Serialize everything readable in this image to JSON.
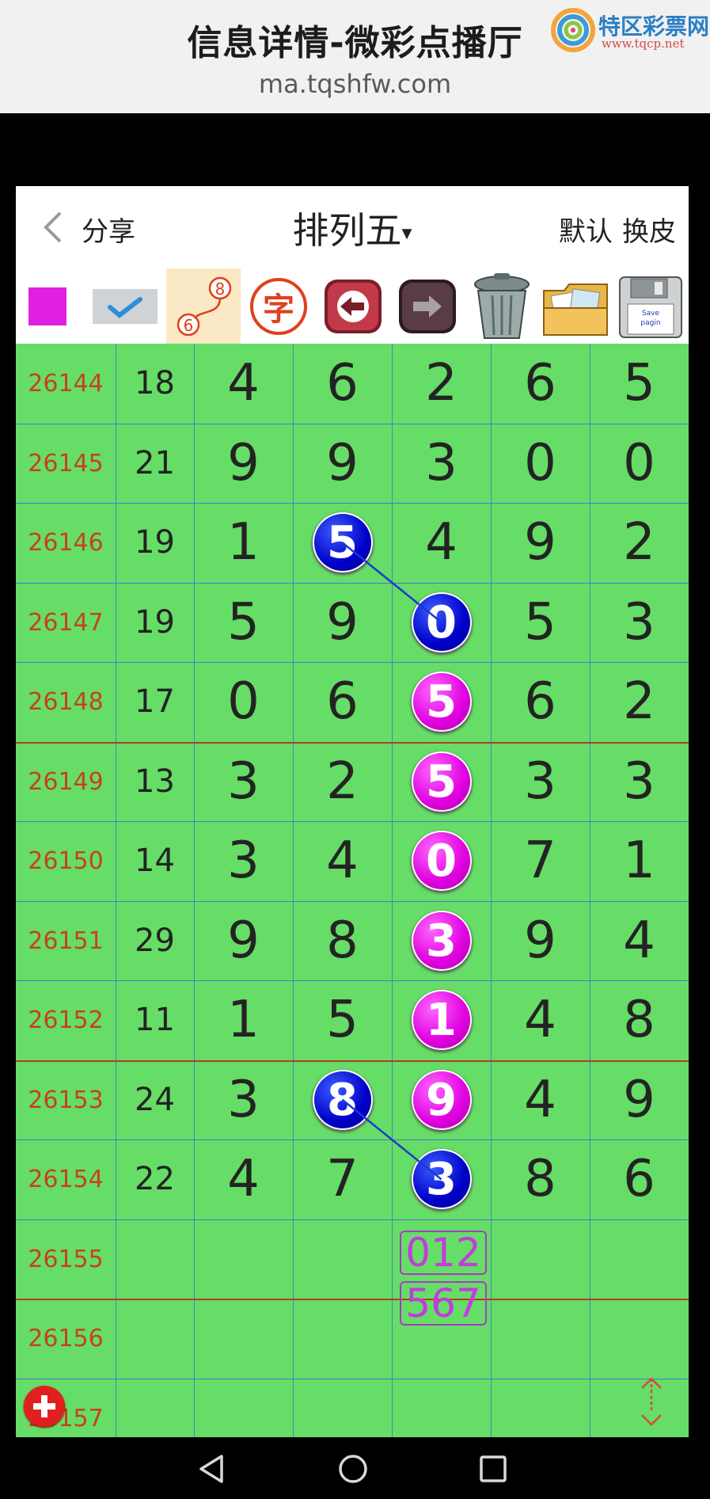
{
  "browser": {
    "title": "信息详情-微彩点播厅",
    "url": "ma.tqshfw.com",
    "logo_text": "特区彩票网",
    "logo_sub": "www.tqcp.net"
  },
  "header": {
    "back_icon": "chevron-left-icon",
    "share_label": "分享",
    "title": "排列五",
    "caret": "▾",
    "default_label": "默认",
    "skin_label": "换皮"
  },
  "toolbar": {
    "tools": [
      {
        "name": "color-swatch",
        "color": "#e020e0"
      },
      {
        "name": "check-toggle",
        "color": "#2b8fd8"
      },
      {
        "name": "trend-line-tool",
        "label_top": "8",
        "label_bottom": "6"
      },
      {
        "name": "text-tool",
        "label": "字"
      },
      {
        "name": "undo-arrow-icon"
      },
      {
        "name": "redo-arrow-icon"
      },
      {
        "name": "trash-icon"
      },
      {
        "name": "wallpaper-icon"
      },
      {
        "name": "save-disk-icon",
        "label_1": "Save",
        "label_2": "pagin"
      }
    ]
  },
  "colors": {
    "grid_background": "#66dd66",
    "issue_text": "#c6421c",
    "blue_ball": "#0000c8",
    "purple_ball": "#e000e0",
    "predict_text": "#c43ae0"
  },
  "rows": [
    {
      "issue": "26144",
      "sum": "18",
      "digits": [
        "4",
        "6",
        "2",
        "6",
        "5"
      ]
    },
    {
      "issue": "26145",
      "sum": "21",
      "digits": [
        "9",
        "9",
        "3",
        "0",
        "0"
      ]
    },
    {
      "issue": "26146",
      "sum": "19",
      "digits": [
        "1",
        "5",
        "4",
        "9",
        "2"
      ]
    },
    {
      "issue": "26147",
      "sum": "19",
      "digits": [
        "5",
        "9",
        "0",
        "5",
        "3"
      ]
    },
    {
      "issue": "26148",
      "sum": "17",
      "digits": [
        "0",
        "6",
        "5",
        "6",
        "2"
      ]
    },
    {
      "issue": "26149",
      "sum": "13",
      "digits": [
        "3",
        "2",
        "5",
        "3",
        "3"
      ]
    },
    {
      "issue": "26150",
      "sum": "14",
      "digits": [
        "3",
        "4",
        "0",
        "7",
        "1"
      ]
    },
    {
      "issue": "26151",
      "sum": "29",
      "digits": [
        "9",
        "8",
        "3",
        "9",
        "4"
      ]
    },
    {
      "issue": "26152",
      "sum": "11",
      "digits": [
        "1",
        "5",
        "1",
        "4",
        "8"
      ]
    },
    {
      "issue": "26153",
      "sum": "24",
      "digits": [
        "3",
        "8",
        "9",
        "4",
        "9"
      ]
    },
    {
      "issue": "26154",
      "sum": "22",
      "digits": [
        "4",
        "7",
        "3",
        "8",
        "6"
      ]
    },
    {
      "issue": "26155",
      "sum": "",
      "digits": [
        "",
        "",
        "",
        "",
        ""
      ]
    },
    {
      "issue": "26156",
      "sum": "",
      "digits": [
        "",
        "",
        "",
        "",
        ""
      ]
    },
    {
      "issue": "26157",
      "sum": "",
      "digits": [
        "",
        "",
        "",
        "",
        ""
      ]
    }
  ],
  "highlights": [
    {
      "row": 2,
      "col": 1,
      "color": "blue"
    },
    {
      "row": 3,
      "col": 2,
      "color": "blue"
    },
    {
      "row": 4,
      "col": 2,
      "color": "purple"
    },
    {
      "row": 5,
      "col": 2,
      "color": "purple"
    },
    {
      "row": 6,
      "col": 2,
      "color": "purple"
    },
    {
      "row": 7,
      "col": 2,
      "color": "purple"
    },
    {
      "row": 8,
      "col": 2,
      "color": "purple"
    },
    {
      "row": 9,
      "col": 2,
      "color": "purple"
    },
    {
      "row": 9,
      "col": 1,
      "color": "blue"
    },
    {
      "row": 10,
      "col": 2,
      "color": "blue"
    }
  ],
  "lines": [
    {
      "from": [
        2,
        1
      ],
      "to": [
        3,
        2
      ]
    },
    {
      "from": [
        9,
        1
      ],
      "to": [
        10,
        2
      ]
    }
  ],
  "predictions": [
    "012",
    "567"
  ],
  "controls": {
    "add_icon": "plus-circle-icon",
    "scroll_icon": "up-down-arrows-icon"
  },
  "navbar": {
    "back_icon": "triangle-back-icon",
    "home_icon": "circle-home-icon",
    "recents_icon": "square-recents-icon"
  }
}
